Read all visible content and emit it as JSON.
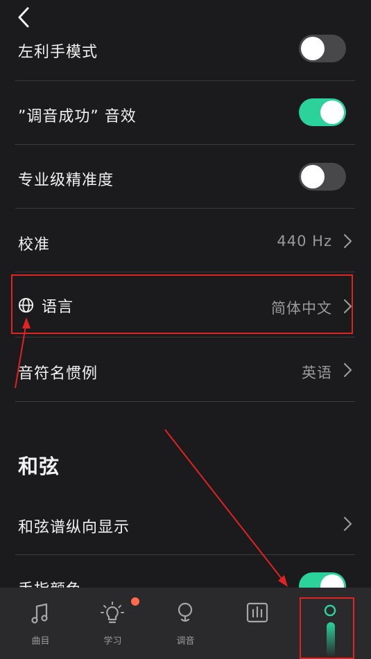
{
  "header": {
    "back_icon": "chevron-left-icon"
  },
  "settings": {
    "lefty_mode": {
      "label": "左利手模式",
      "enabled": false
    },
    "tune_success_sound": {
      "label": "”调音成功” 音效",
      "enabled": true
    },
    "pro_precision": {
      "label": "专业级精准度",
      "enabled": false
    },
    "calibration": {
      "label": "校准",
      "value": "440 Hz"
    },
    "language": {
      "label": "语言",
      "value": "简体中文",
      "icon": "globe-icon"
    },
    "note_naming": {
      "label": "音符名惯例",
      "value": "英语"
    }
  },
  "chords_section": {
    "title": "和弦",
    "vertical_chart": {
      "label": "和弦谱纵向显示"
    },
    "finger_color": {
      "label": "手指颜色",
      "enabled": true
    }
  },
  "tabbar": {
    "tabs": [
      {
        "label": "曲目",
        "icon": "music-note-icon"
      },
      {
        "label": "学习",
        "icon": "lightbulb-icon",
        "badge": true
      },
      {
        "label": "调音",
        "icon": "tuner-icon"
      },
      {
        "label": "",
        "icon": "soundwave-icon"
      },
      {
        "label": "",
        "icon": "profile-icon",
        "active": true
      }
    ]
  },
  "colors": {
    "background": "#1b1b1d",
    "accent": "#2bd39b",
    "annotation": "#e02323",
    "badge": "#ff6b4a"
  }
}
